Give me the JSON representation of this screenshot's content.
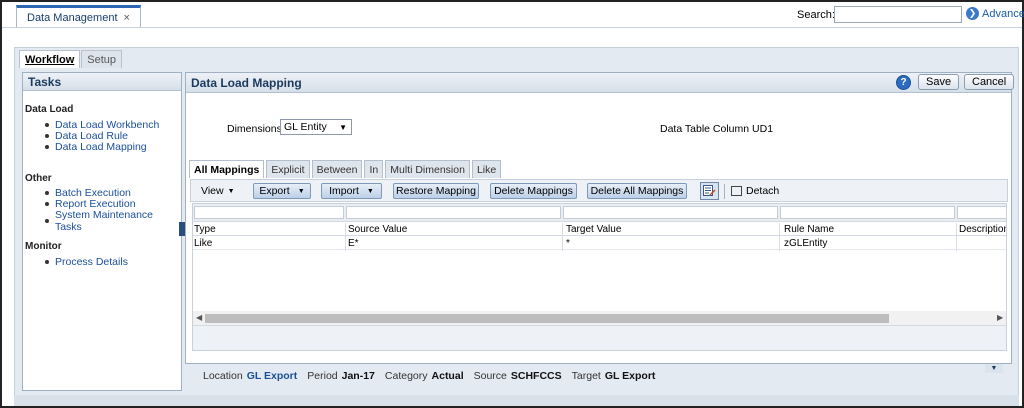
{
  "app": {
    "doc_tab_label": "Data Management",
    "doc_tab_close": "×",
    "search_label": "Search:",
    "search_value": "",
    "advanced_label": "Advanced"
  },
  "workflow_tabs": [
    {
      "label": "Workflow",
      "active": true
    },
    {
      "label": "Setup",
      "active": false
    }
  ],
  "tasks": {
    "title": "Tasks",
    "groups": [
      {
        "label": "Data Load",
        "items": [
          "Data Load Workbench",
          "Data Load Rule",
          "Data Load Mapping"
        ]
      },
      {
        "label": "Other",
        "items": [
          "Batch Execution",
          "Report Execution",
          "System Maintenance Tasks"
        ]
      },
      {
        "label": "Monitor",
        "items": [
          "Process Details"
        ]
      }
    ]
  },
  "panel": {
    "title": "Data Load Mapping",
    "help_label": "?",
    "save_label": "Save",
    "cancel_label": "Cancel",
    "dimensions_label": "Dimensions",
    "dimensions_value": "GL Entity",
    "data_table_column_label": "Data Table Column",
    "data_table_column_value": "UD1"
  },
  "mapping_tabs": [
    {
      "label": "All Mappings",
      "active": true
    },
    {
      "label": "Explicit",
      "active": false
    },
    {
      "label": "Between",
      "active": false
    },
    {
      "label": "In",
      "active": false
    },
    {
      "label": "Multi Dimension",
      "active": false
    },
    {
      "label": "Like",
      "active": false
    }
  ],
  "toolbar": {
    "view_label": "View",
    "export_label": "Export",
    "import_label": "Import",
    "restore_label": "Restore Mapping",
    "delete_label": "Delete Mappings",
    "delete_all_label": "Delete All Mappings",
    "detach_label": "Detach"
  },
  "grid": {
    "columns": [
      "Type",
      "Source Value",
      "Target Value",
      "Rule Name",
      "Description"
    ],
    "rows": [
      [
        "Like",
        "E*",
        "*",
        "zGLEntity",
        ""
      ]
    ]
  },
  "pov": {
    "location_label": "Location",
    "location_value": "GL Export",
    "period_label": "Period",
    "period_value": "Jan-17",
    "category_label": "Category",
    "category_value": "Actual",
    "source_label": "Source",
    "source_value": "SCHFCCS",
    "target_label": "Target",
    "target_value": "GL Export"
  }
}
